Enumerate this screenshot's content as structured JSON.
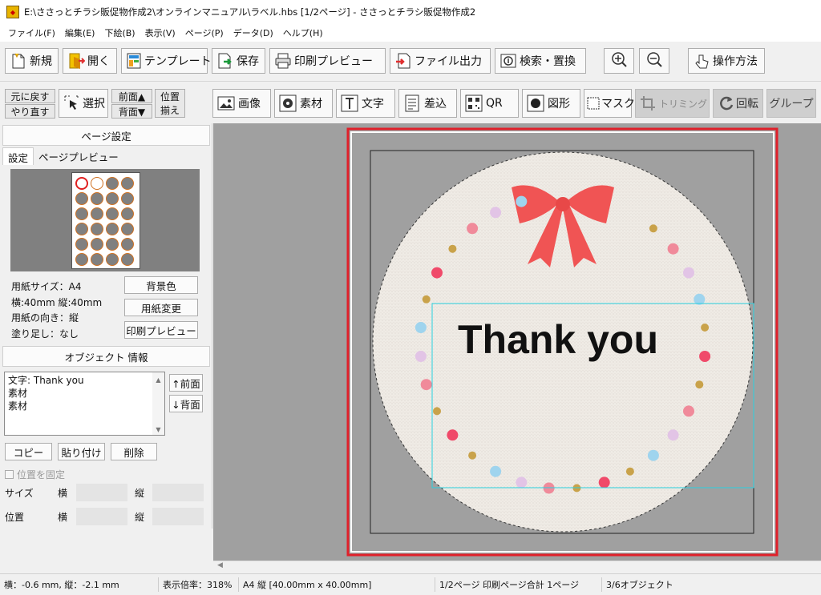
{
  "window": {
    "title": "E:\\ささっとチラシ販促物作成2\\オンラインマニュアル\\ラベル.hbs  [1/2ページ] - ささっとチラシ販促物作成2"
  },
  "menu": [
    "ファイル(F)",
    "編集(E)",
    "下絵(B)",
    "表示(V)",
    "ページ(P)",
    "データ(D)",
    "ヘルプ(H)"
  ],
  "toolbar": {
    "new": "新規",
    "open": "開く",
    "template": "テンプレート",
    "save": "保存",
    "print_preview": "印刷プレビュー",
    "file_export": "ファイル出力",
    "search_replace": "検索・置換",
    "how_to": "操作方法"
  },
  "edit_toolbar": {
    "undo": "元に戻す",
    "redo": "やり直す",
    "select": "選択",
    "front": "前面▲",
    "back": "背面▼",
    "align_top": "位置",
    "align_bottom": "揃え",
    "image": "画像",
    "material": "素材",
    "text": "文字",
    "merge": "差込",
    "qr": "QR",
    "shape": "図形",
    "mask": "マスク",
    "trimming": "トリミング",
    "rotate": "回転",
    "group": "グループ"
  },
  "page_settings": {
    "header": "ページ設定",
    "tab_settings": "設定",
    "tab_preview": "ページプレビュー",
    "paper_size": "用紙サイズ：A4",
    "dimensions": "横:40mm 縦:40mm",
    "orientation": "用紙の向き：縦",
    "bleed": "塗り足し：なし",
    "bg_color_btn": "背景色",
    "change_paper_btn": "用紙変更",
    "print_preview_btn": "印刷プレビュー"
  },
  "object_info": {
    "header": "オブジェクト 情報",
    "items": [
      "文字: Thank you",
      "素材",
      "素材"
    ],
    "front_btn": "↑前面",
    "back_btn": "↓背面",
    "copy_btn": "コピー",
    "paste_btn": "貼り付け",
    "delete_btn": "削除",
    "lock_label": "位置を固定",
    "size_label": "サイズ",
    "pos_label": "位置",
    "w_label": "横",
    "h_label": "縦"
  },
  "canvas": {
    "label_text": "Thank you"
  },
  "status": {
    "coords": "横：-0.6 mm, 縦：-2.1 mm",
    "zoom": "表示倍率：318%",
    "paper": "A4 縦 [40.00mm x 40.00mm]",
    "pages": "1/2ページ 印刷ページ合計 1ページ",
    "objects": "3/6オブジェクト"
  },
  "colors": {
    "accent_red": "#e0202a",
    "ribbon": "#f05454",
    "label_bg": "#efebe5"
  }
}
